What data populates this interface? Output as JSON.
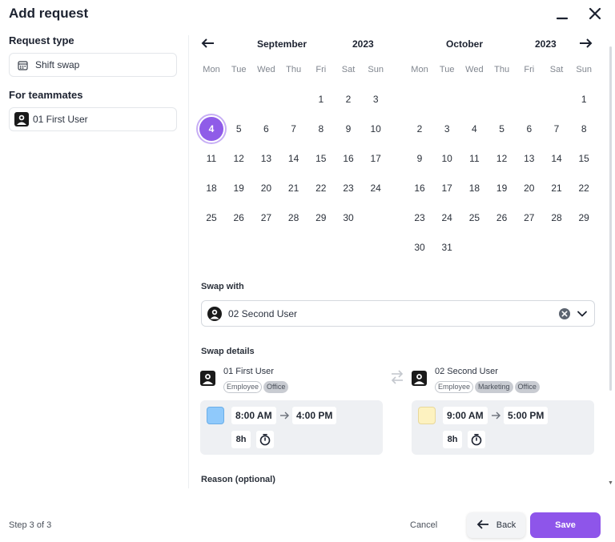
{
  "header": {
    "title": "Add request"
  },
  "left": {
    "request_type_label": "Request type",
    "request_type_value": "Shift swap",
    "teammates_label": "For teammates",
    "teammate_value": "01 First User"
  },
  "calendar": {
    "weekdays": [
      "Mon",
      "Tue",
      "Wed",
      "Thu",
      "Fri",
      "Sat",
      "Sun"
    ],
    "left": {
      "month": "September",
      "year": "2023",
      "rows": [
        [
          "",
          "",
          "",
          "",
          "1",
          "2",
          "3"
        ],
        [
          "4",
          "5",
          "6",
          "7",
          "8",
          "9",
          "10"
        ],
        [
          "11",
          "12",
          "13",
          "14",
          "15",
          "16",
          "17"
        ],
        [
          "18",
          "19",
          "20",
          "21",
          "22",
          "23",
          "24"
        ],
        [
          "25",
          "26",
          "27",
          "28",
          "29",
          "30",
          ""
        ]
      ],
      "selected": "4"
    },
    "right": {
      "month": "October",
      "year": "2023",
      "rows": [
        [
          "",
          "",
          "",
          "",
          "",
          "",
          "1"
        ],
        [
          "2",
          "3",
          "4",
          "5",
          "6",
          "7",
          "8"
        ],
        [
          "9",
          "10",
          "11",
          "12",
          "13",
          "14",
          "15"
        ],
        [
          "16",
          "17",
          "18",
          "19",
          "20",
          "21",
          "22"
        ],
        [
          "23",
          "24",
          "25",
          "26",
          "27",
          "28",
          "29"
        ],
        [
          "30",
          "31",
          "",
          "",
          "",
          "",
          ""
        ]
      ]
    }
  },
  "swap_with": {
    "label": "Swap with",
    "value": "02 Second User"
  },
  "swap_details": {
    "label": "Swap details",
    "first": {
      "name": "01 First User",
      "tags": [
        {
          "text": "Employee",
          "filled": false
        },
        {
          "text": "Office",
          "filled": true
        }
      ],
      "color": "#8fc9fb",
      "start": "8:00 AM",
      "end": "4:00 PM",
      "duration": "8h"
    },
    "second": {
      "name": "02 Second User",
      "tags": [
        {
          "text": "Employee",
          "filled": false
        },
        {
          "text": "Marketing",
          "filled": true
        },
        {
          "text": "Office",
          "filled": true
        }
      ],
      "color": "#fdf2c0",
      "start": "9:00 AM",
      "end": "5:00 PM",
      "duration": "8h"
    }
  },
  "reason": {
    "label": "Reason (optional)"
  },
  "footer": {
    "step": "Step 3 of 3",
    "cancel": "Cancel",
    "back": "Back",
    "save": "Save"
  },
  "colors": {
    "accent": "#8e55ea",
    "selected_day": "#8f5ce8"
  },
  "icons": [
    "minimize-icon",
    "close-icon",
    "calendar-icon",
    "avatar-icon",
    "arrow-left-icon",
    "arrow-right-icon",
    "clear-icon",
    "chevron-down-icon",
    "swap-arrows-icon",
    "timer-icon"
  ]
}
